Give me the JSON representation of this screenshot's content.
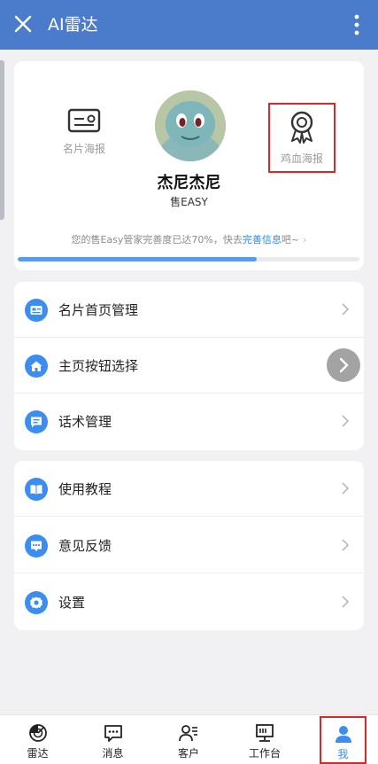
{
  "header": {
    "title": "AI雷达"
  },
  "profile": {
    "card_poster_label": "名片海报",
    "motivation_poster_label": "鸡血海报",
    "name": "杰尼杰尼",
    "company": "售EASY",
    "hint_prefix": "您的售Easy管家完善度已达70%，快去",
    "hint_link": "完善信息",
    "hint_suffix": "吧~",
    "completion": 0.7
  },
  "menu_group_1": [
    {
      "label": "名片首页管理",
      "icon": "card-icon"
    },
    {
      "label": "主页按钮选择",
      "icon": "home-icon"
    },
    {
      "label": "话术管理",
      "icon": "chat-icon"
    }
  ],
  "menu_group_2": [
    {
      "label": "使用教程",
      "icon": "book-icon"
    },
    {
      "label": "意见反馈",
      "icon": "feedback-icon"
    },
    {
      "label": "设置",
      "icon": "settings-icon"
    }
  ],
  "tabs": [
    {
      "label": "雷达",
      "icon": "radar-icon"
    },
    {
      "label": "消息",
      "icon": "message-icon"
    },
    {
      "label": "客户",
      "icon": "customer-icon"
    },
    {
      "label": "工作台",
      "icon": "workbench-icon"
    },
    {
      "label": "我",
      "icon": "me-icon",
      "active": true
    }
  ],
  "colors": {
    "header": "#4a7ccb",
    "accent": "#3a8ef0",
    "highlight_box": "#e02525"
  }
}
